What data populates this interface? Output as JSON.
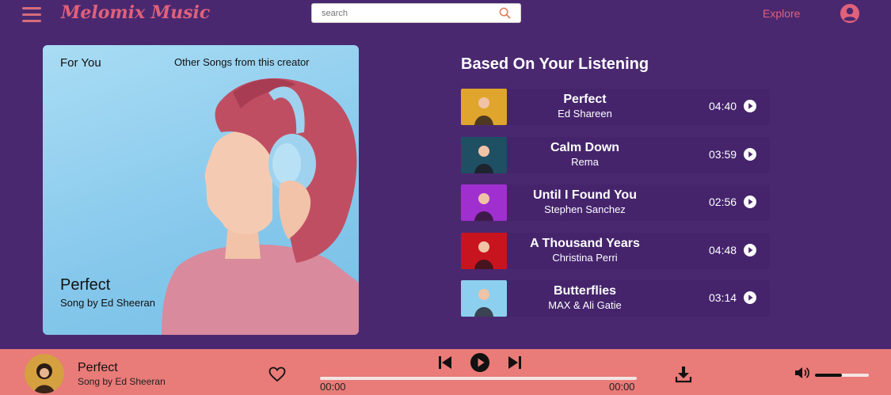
{
  "header": {
    "brand": "Melomix Music",
    "search_placeholder": "search",
    "explore_label": "Explore"
  },
  "featured": {
    "tab_for_you": "For You",
    "tab_other": "Other Songs from this creator",
    "title": "Perfect",
    "subtitle": "Song by Ed Sheeran"
  },
  "listening": {
    "title": "Based On Your Listening",
    "songs": [
      {
        "title": "Perfect",
        "artist": "Ed Shareen",
        "duration": "04:40",
        "thumb_color": "#e0a52c"
      },
      {
        "title": "Calm Down",
        "artist": "Rema",
        "duration": "03:59",
        "thumb_color": "#1f4f63"
      },
      {
        "title": "Until I Found You",
        "artist": "Stephen Sanchez",
        "duration": "02:56",
        "thumb_color": "#a02fd0"
      },
      {
        "title": "A Thousand Years",
        "artist": "Christina Perri",
        "duration": "04:48",
        "thumb_color": "#c8141e"
      },
      {
        "title": "Butterflies",
        "artist": "MAX & Ali Gatie",
        "duration": "03:14",
        "thumb_color": "#8dcfee"
      }
    ]
  },
  "player": {
    "title": "Perfect",
    "subtitle": "Song by Ed Sheeran",
    "current_time": "00:00",
    "total_time": "00:00",
    "progress_fraction": 0,
    "volume_fraction": 0.5
  },
  "colors": {
    "background": "#4a2870",
    "accent": "#e0617a",
    "player_bar": "#e97b78"
  }
}
